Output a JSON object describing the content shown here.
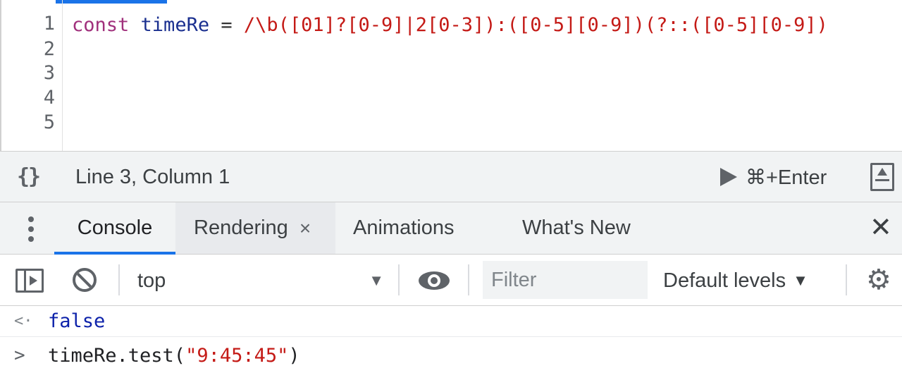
{
  "editor": {
    "line_numbers": [
      "1",
      "2",
      "3",
      "4",
      "5"
    ],
    "code": {
      "keyword": "const",
      "identifier": "timeRe",
      "operator": "=",
      "regex": "/\\b([01]?[0-9]|2[0-3]):([0-5][0-9])(?::([0-5][0-9])"
    }
  },
  "statusbar": {
    "braces_icon": "{}",
    "cursor_position": "Line 3, Column 1",
    "run_label": "⌘+Enter"
  },
  "drawer": {
    "tabs": [
      {
        "label": "Console",
        "active": true
      },
      {
        "label": "Rendering",
        "closable": true
      },
      {
        "label": "Animations"
      },
      {
        "label": "What's New"
      }
    ],
    "tab_close_glyph": "×",
    "close_glyph": "✕"
  },
  "console_toolbar": {
    "context": "top",
    "context_caret": "▼",
    "filter_placeholder": "Filter",
    "levels_label": "Default levels",
    "levels_caret": "▼",
    "gear_glyph": "⚙"
  },
  "console": {
    "result_icon": "<·",
    "result_value": "false",
    "prompt_icon": ">",
    "input": {
      "prefix": "timeRe.test(",
      "string": "\"9:45:45\"",
      "suffix": ")"
    }
  },
  "colors": {
    "accent": "#1a73e8",
    "keyword": "#a0307c",
    "regex": "#c41a16",
    "boolean": "#0d22aa"
  }
}
